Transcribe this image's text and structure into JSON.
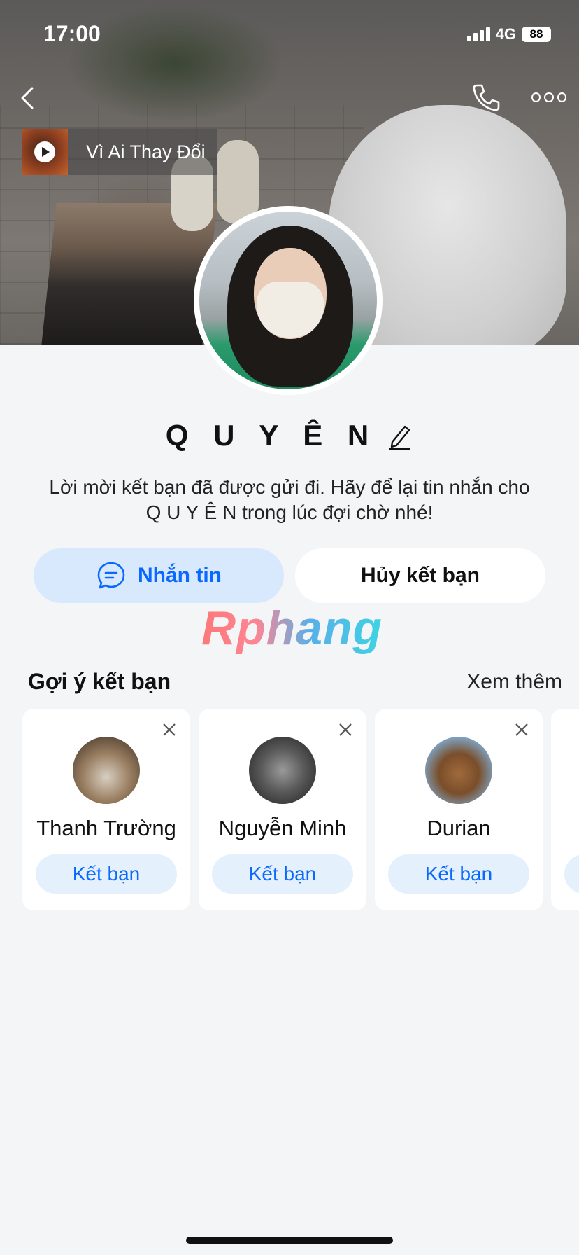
{
  "status_bar": {
    "time": "17:00",
    "network": "4G",
    "battery": "88"
  },
  "header": {
    "back_icon": "chevron-left-icon",
    "call_icon": "phone-icon",
    "more_icon": "more-dots-icon"
  },
  "music": {
    "title": "Vì Ai Thay Đổi",
    "icon": "play-icon"
  },
  "profile": {
    "name": "Q U Y Ê N",
    "edit_icon": "pencil-icon",
    "status_message": "Lời mời kết bạn đã được gửi đi. Hãy để lại tin nhắn cho Q U Y Ê N trong lúc đợi chờ nhé!"
  },
  "actions": {
    "message_label": "Nhắn tin",
    "message_icon": "chat-bubble-icon",
    "unfriend_label": "Hủy kết bạn"
  },
  "watermark": "Rphang",
  "suggestions": {
    "title": "Gợi ý kết bạn",
    "see_more": "Xem thêm",
    "items": [
      {
        "name": "Thanh Trường",
        "button": "Kết bạn"
      },
      {
        "name": "Nguyễn Minh",
        "button": "Kết bạn"
      },
      {
        "name": "Durian",
        "button": "Kết bạn"
      }
    ]
  },
  "colors": {
    "accent": "#0a68ff",
    "accent_bg": "#d9e9fd",
    "page_bg": "#f4f5f7"
  }
}
